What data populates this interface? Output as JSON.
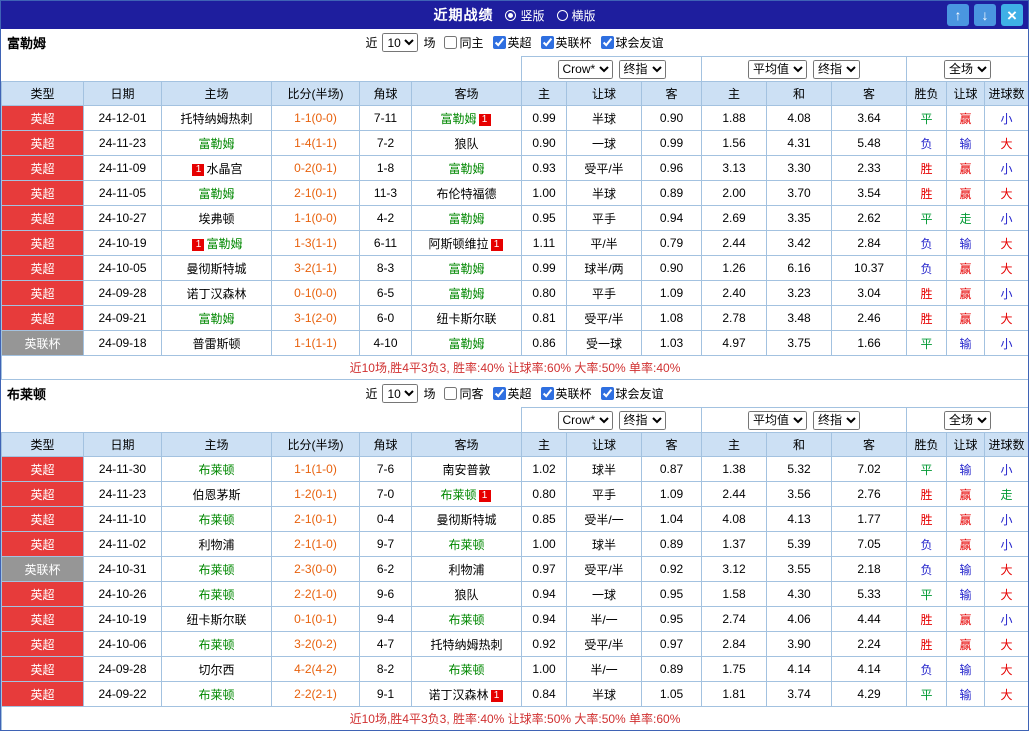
{
  "topbar": {
    "title": "近期战绩",
    "radios": [
      {
        "label": "竖版",
        "checked": true
      },
      {
        "label": "横版",
        "checked": false
      }
    ],
    "buttons": [
      {
        "name": "scroll-up",
        "glyph": "↑"
      },
      {
        "name": "scroll-down",
        "glyph": "↓"
      },
      {
        "name": "close",
        "glyph": "×"
      }
    ]
  },
  "columns": [
    "类型",
    "日期",
    "主场",
    "比分(半场)",
    "角球",
    "客场",
    "主",
    "让球",
    "客",
    "主",
    "和",
    "客",
    "胜负",
    "让球",
    "进球数"
  ],
  "selects": {
    "bookmaker": "Crow*",
    "asia_time": "终指",
    "average": "平均值",
    "europe_time": "终指",
    "scope": "全场"
  },
  "league_colors": {
    "英超": "red",
    "英联杯": "gray"
  },
  "result_colors": {
    "胜": "red",
    "赢": "red",
    "大": "red",
    "平": "green",
    "走": "green",
    "负": "blue",
    "输": "blue",
    "小": "blue"
  },
  "colors": {
    "topbar_bg": "#1e1e9e",
    "header_bg": "#cce0f4",
    "grid_border": "#a3c2e0",
    "league_red": "#e73b3b",
    "league_gray": "#969696",
    "team_green": "#008800",
    "score_orange": "#e8610c",
    "win_red": "#e60000",
    "draw_green": "#009933",
    "loss_blue": "#2525cc",
    "summary_red": "#d03030",
    "button_blue": "#4a96e0"
  },
  "sections": [
    {
      "team": "富勒姆",
      "filters": {
        "prefix": "近",
        "count": "10",
        "suffix": "场",
        "venue": {
          "label": "同主",
          "checked": false
        },
        "leagues": [
          {
            "label": "英超",
            "checked": true
          },
          {
            "label": "英联杯",
            "checked": true
          },
          {
            "label": "球会友谊",
            "checked": true
          }
        ]
      },
      "rows": [
        {
          "type": "英超",
          "date": "24-12-01",
          "home": {
            "name": "托特纳姆热刺"
          },
          "score": "1-1(0-0)",
          "corners": "7-11",
          "away": {
            "name": "富勒姆",
            "self": true,
            "red_after": "1"
          },
          "asia": [
            "0.99",
            "半球",
            "0.90"
          ],
          "europe": [
            "1.88",
            "4.08",
            "3.64"
          ],
          "results": [
            "平",
            "赢",
            "小"
          ]
        },
        {
          "type": "英超",
          "date": "24-11-23",
          "home": {
            "name": "富勒姆",
            "self": true
          },
          "score": "1-4(1-1)",
          "corners": "7-2",
          "away": {
            "name": "狼队"
          },
          "asia": [
            "0.90",
            "一球",
            "0.99"
          ],
          "europe": [
            "1.56",
            "4.31",
            "5.48"
          ],
          "results": [
            "负",
            "输",
            "大"
          ]
        },
        {
          "type": "英超",
          "date": "24-11-09",
          "home": {
            "name": "水晶宫",
            "red_before": "1"
          },
          "score": "0-2(0-1)",
          "corners": "1-8",
          "away": {
            "name": "富勒姆",
            "self": true
          },
          "asia": [
            "0.93",
            "受平/半",
            "0.96"
          ],
          "europe": [
            "3.13",
            "3.30",
            "2.33"
          ],
          "results": [
            "胜",
            "赢",
            "小"
          ]
        },
        {
          "type": "英超",
          "date": "24-11-05",
          "home": {
            "name": "富勒姆",
            "self": true
          },
          "score": "2-1(0-1)",
          "corners": "11-3",
          "away": {
            "name": "布伦特福德"
          },
          "asia": [
            "1.00",
            "半球",
            "0.89"
          ],
          "europe": [
            "2.00",
            "3.70",
            "3.54"
          ],
          "results": [
            "胜",
            "赢",
            "大"
          ]
        },
        {
          "type": "英超",
          "date": "24-10-27",
          "home": {
            "name": "埃弗顿"
          },
          "score": "1-1(0-0)",
          "corners": "4-2",
          "away": {
            "name": "富勒姆",
            "self": true
          },
          "asia": [
            "0.95",
            "平手",
            "0.94"
          ],
          "europe": [
            "2.69",
            "3.35",
            "2.62"
          ],
          "results": [
            "平",
            "走",
            "小"
          ]
        },
        {
          "type": "英超",
          "date": "24-10-19",
          "home": {
            "name": "富勒姆",
            "self": true,
            "red_before": "1"
          },
          "score": "1-3(1-1)",
          "corners": "6-11",
          "away": {
            "name": "阿斯顿维拉",
            "red_after": "1"
          },
          "asia": [
            "1.11",
            "平/半",
            "0.79"
          ],
          "europe": [
            "2.44",
            "3.42",
            "2.84"
          ],
          "results": [
            "负",
            "输",
            "大"
          ]
        },
        {
          "type": "英超",
          "date": "24-10-05",
          "home": {
            "name": "曼彻斯特城"
          },
          "score": "3-2(1-1)",
          "corners": "8-3",
          "away": {
            "name": "富勒姆",
            "self": true
          },
          "asia": [
            "0.99",
            "球半/两",
            "0.90"
          ],
          "europe": [
            "1.26",
            "6.16",
            "10.37"
          ],
          "results": [
            "负",
            "赢",
            "大"
          ]
        },
        {
          "type": "英超",
          "date": "24-09-28",
          "home": {
            "name": "诺丁汉森林"
          },
          "score": "0-1(0-0)",
          "corners": "6-5",
          "away": {
            "name": "富勒姆",
            "self": true
          },
          "asia": [
            "0.80",
            "平手",
            "1.09"
          ],
          "europe": [
            "2.40",
            "3.23",
            "3.04"
          ],
          "results": [
            "胜",
            "赢",
            "小"
          ]
        },
        {
          "type": "英超",
          "date": "24-09-21",
          "home": {
            "name": "富勒姆",
            "self": true
          },
          "score": "3-1(2-0)",
          "corners": "6-0",
          "away": {
            "name": "纽卡斯尔联"
          },
          "asia": [
            "0.81",
            "受平/半",
            "1.08"
          ],
          "europe": [
            "2.78",
            "3.48",
            "2.46"
          ],
          "results": [
            "胜",
            "赢",
            "大"
          ]
        },
        {
          "type": "英联杯",
          "date": "24-09-18",
          "home": {
            "name": "普雷斯顿"
          },
          "score": "1-1(1-1)",
          "corners": "4-10",
          "away": {
            "name": "富勒姆",
            "self": true
          },
          "asia": [
            "0.86",
            "受一球",
            "1.03"
          ],
          "europe": [
            "4.97",
            "3.75",
            "1.66"
          ],
          "results": [
            "平",
            "输",
            "小"
          ]
        }
      ],
      "summary": "近10场,胜4平3负3, 胜率:40% 让球率:60% 大率:50% 单率:40%"
    },
    {
      "team": "布莱顿",
      "filters": {
        "prefix": "近",
        "count": "10",
        "suffix": "场",
        "venue": {
          "label": "同客",
          "checked": false
        },
        "leagues": [
          {
            "label": "英超",
            "checked": true
          },
          {
            "label": "英联杯",
            "checked": true
          },
          {
            "label": "球会友谊",
            "checked": true
          }
        ]
      },
      "rows": [
        {
          "type": "英超",
          "date": "24-11-30",
          "home": {
            "name": "布莱顿",
            "self": true
          },
          "score": "1-1(1-0)",
          "corners": "7-6",
          "away": {
            "name": "南安普敦"
          },
          "asia": [
            "1.02",
            "球半",
            "0.87"
          ],
          "europe": [
            "1.38",
            "5.32",
            "7.02"
          ],
          "results": [
            "平",
            "输",
            "小"
          ]
        },
        {
          "type": "英超",
          "date": "24-11-23",
          "home": {
            "name": "伯恩茅斯"
          },
          "score": "1-2(0-1)",
          "corners": "7-0",
          "away": {
            "name": "布莱顿",
            "self": true,
            "red_after": "1"
          },
          "asia": [
            "0.80",
            "平手",
            "1.09"
          ],
          "europe": [
            "2.44",
            "3.56",
            "2.76"
          ],
          "results": [
            "胜",
            "赢",
            "走"
          ]
        },
        {
          "type": "英超",
          "date": "24-11-10",
          "home": {
            "name": "布莱顿",
            "self": true
          },
          "score": "2-1(0-1)",
          "corners": "0-4",
          "away": {
            "name": "曼彻斯特城"
          },
          "asia": [
            "0.85",
            "受半/一",
            "1.04"
          ],
          "europe": [
            "4.08",
            "4.13",
            "1.77"
          ],
          "results": [
            "胜",
            "赢",
            "小"
          ]
        },
        {
          "type": "英超",
          "date": "24-11-02",
          "home": {
            "name": "利物浦"
          },
          "score": "2-1(1-0)",
          "corners": "9-7",
          "away": {
            "name": "布莱顿",
            "self": true
          },
          "asia": [
            "1.00",
            "球半",
            "0.89"
          ],
          "europe": [
            "1.37",
            "5.39",
            "7.05"
          ],
          "results": [
            "负",
            "赢",
            "小"
          ]
        },
        {
          "type": "英联杯",
          "date": "24-10-31",
          "home": {
            "name": "布莱顿",
            "self": true
          },
          "score": "2-3(0-0)",
          "corners": "6-2",
          "away": {
            "name": "利物浦"
          },
          "asia": [
            "0.97",
            "受平/半",
            "0.92"
          ],
          "europe": [
            "3.12",
            "3.55",
            "2.18"
          ],
          "results": [
            "负",
            "输",
            "大"
          ]
        },
        {
          "type": "英超",
          "date": "24-10-26",
          "home": {
            "name": "布莱顿",
            "self": true
          },
          "score": "2-2(1-0)",
          "corners": "9-6",
          "away": {
            "name": "狼队"
          },
          "asia": [
            "0.94",
            "一球",
            "0.95"
          ],
          "europe": [
            "1.58",
            "4.30",
            "5.33"
          ],
          "results": [
            "平",
            "输",
            "大"
          ]
        },
        {
          "type": "英超",
          "date": "24-10-19",
          "home": {
            "name": "纽卡斯尔联"
          },
          "score": "0-1(0-1)",
          "corners": "9-4",
          "away": {
            "name": "布莱顿",
            "self": true
          },
          "asia": [
            "0.94",
            "半/一",
            "0.95"
          ],
          "europe": [
            "2.74",
            "4.06",
            "4.44"
          ],
          "results": [
            "胜",
            "赢",
            "小"
          ]
        },
        {
          "type": "英超",
          "date": "24-10-06",
          "home": {
            "name": "布莱顿",
            "self": true
          },
          "score": "3-2(0-2)",
          "corners": "4-7",
          "away": {
            "name": "托特纳姆热刺"
          },
          "asia": [
            "0.92",
            "受平/半",
            "0.97"
          ],
          "europe": [
            "2.84",
            "3.90",
            "2.24"
          ],
          "results": [
            "胜",
            "赢",
            "大"
          ]
        },
        {
          "type": "英超",
          "date": "24-09-28",
          "home": {
            "name": "切尔西"
          },
          "score": "4-2(4-2)",
          "corners": "8-2",
          "away": {
            "name": "布莱顿",
            "self": true
          },
          "asia": [
            "1.00",
            "半/一",
            "0.89"
          ],
          "europe": [
            "1.75",
            "4.14",
            "4.14"
          ],
          "results": [
            "负",
            "输",
            "大"
          ]
        },
        {
          "type": "英超",
          "date": "24-09-22",
          "home": {
            "name": "布莱顿",
            "self": true
          },
          "score": "2-2(2-1)",
          "corners": "9-1",
          "away": {
            "name": "诺丁汉森林",
            "red_after": "1"
          },
          "asia": [
            "0.84",
            "半球",
            "1.05"
          ],
          "europe": [
            "1.81",
            "3.74",
            "4.29"
          ],
          "results": [
            "平",
            "输",
            "大"
          ]
        }
      ],
      "summary": "近10场,胜4平3负3, 胜率:40% 让球率:50% 大率:50% 单率:60%"
    }
  ]
}
